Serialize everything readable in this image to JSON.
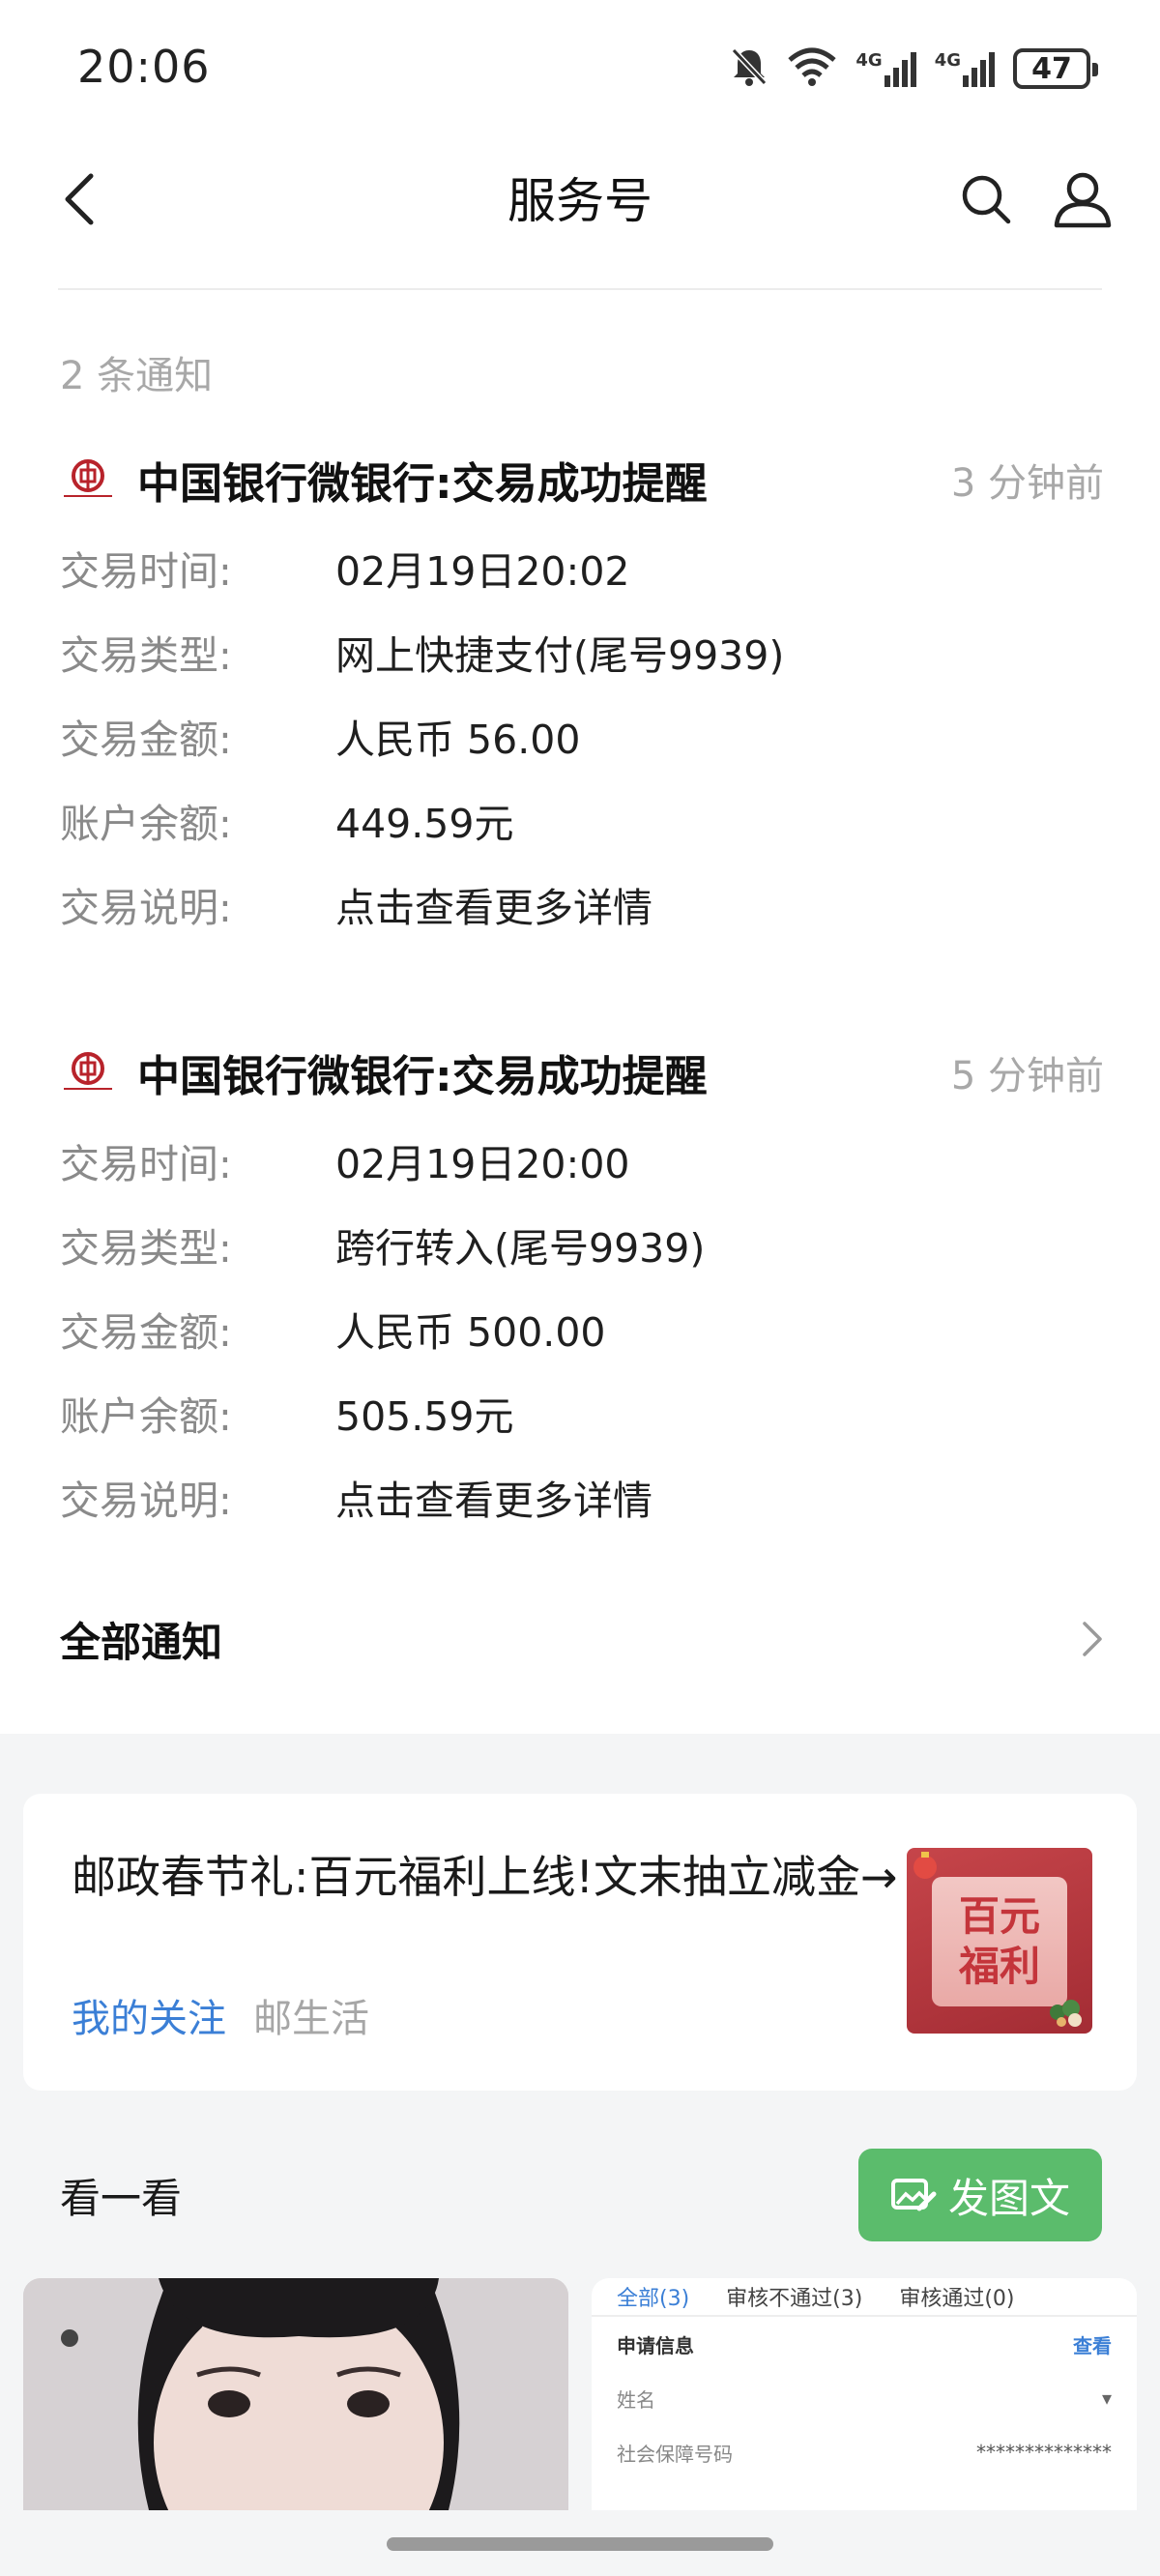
{
  "status_bar": {
    "time": "20:06",
    "battery": "47",
    "network_1": "4G",
    "network_2": "4G"
  },
  "header": {
    "title": "服务号"
  },
  "notifications": {
    "count_label": "2 条通知",
    "items": [
      {
        "title": "中国银行微银行:交易成功提醒",
        "time_ago": "3 分钟前",
        "rows": [
          {
            "key": "交易时间:",
            "value": "02月19日20:02"
          },
          {
            "key": "交易类型:",
            "value": "网上快捷支付(尾号9939)"
          },
          {
            "key": "交易金额:",
            "value": "人民币 56.00"
          },
          {
            "key": "账户余额:",
            "value": "449.59元"
          },
          {
            "key": "交易说明:",
            "value": "点击查看更多详情"
          }
        ]
      },
      {
        "title": "中国银行微银行:交易成功提醒",
        "time_ago": "5 分钟前",
        "rows": [
          {
            "key": "交易时间:",
            "value": "02月19日20:00"
          },
          {
            "key": "交易类型:",
            "value": "跨行转入(尾号9939)"
          },
          {
            "key": "交易金额:",
            "value": "人民币 500.00"
          },
          {
            "key": "账户余额:",
            "value": "505.59元"
          },
          {
            "key": "交易说明:",
            "value": "点击查看更多详情"
          }
        ]
      }
    ],
    "all_label": "全部通知"
  },
  "promo": {
    "text": "邮政春节礼:百元福利上线!文末抽立减金→",
    "follow_label": "我的关注",
    "source": "邮生活",
    "thumb_text_1": "百元",
    "thumb_text_2": "福利"
  },
  "look": {
    "label": "看一看",
    "post_button": "发图文"
  },
  "feed_right": {
    "tabs": [
      "全部(3)",
      "审核不通过(3)",
      "审核通过(0)"
    ],
    "section_title": "申请信息",
    "section_link": "查看",
    "row_1": "姓名",
    "row_2": "社会保障号码",
    "row_2_value": "**************"
  },
  "colors": {
    "accent_blue": "#3b7fd6",
    "post_green": "#5bbc6c",
    "grey_bg": "#f4f5f6",
    "boc_red": "#b8232b"
  }
}
